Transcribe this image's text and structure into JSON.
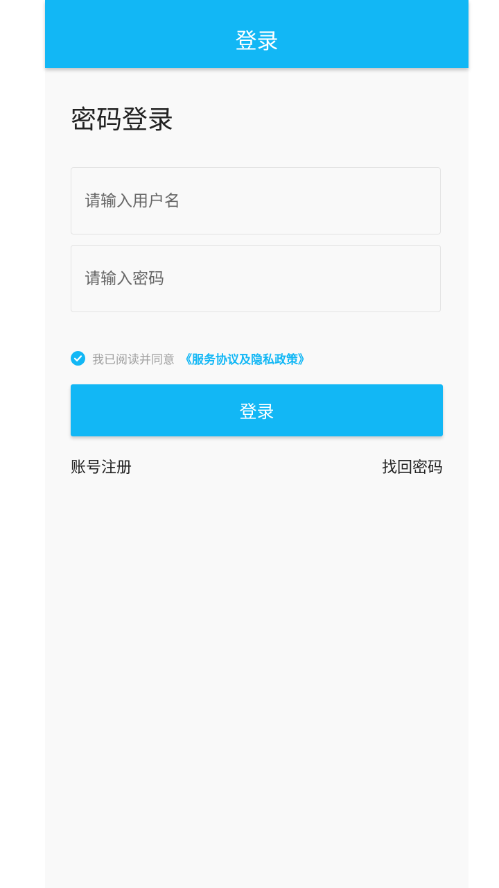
{
  "app_bar": {
    "title": "登录"
  },
  "page": {
    "title": "密码登录"
  },
  "form": {
    "username": {
      "value": "",
      "placeholder": "请输入用户名"
    },
    "password": {
      "value": "",
      "placeholder": "请输入密码"
    },
    "agreement": {
      "checked": true,
      "text": "我已阅读并同意",
      "link": "《服务协议及隐私政策》"
    },
    "submit_label": "登录"
  },
  "links": {
    "register": "账号注册",
    "forgot": "找回密码"
  },
  "colors": {
    "accent": "#12b7f5",
    "background": "#f9f9f9",
    "text": "#222222",
    "muted": "#a0a0a0"
  },
  "icons": {
    "agreement_check": "check-circle-icon"
  }
}
